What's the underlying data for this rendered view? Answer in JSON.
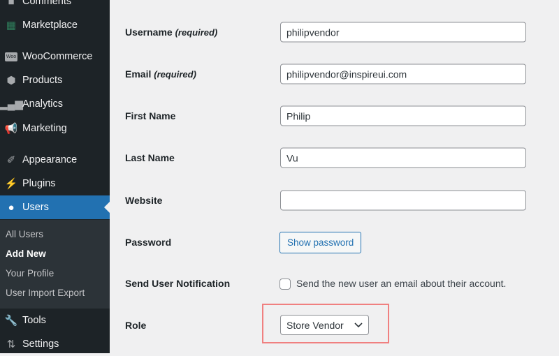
{
  "sidebar": {
    "items": [
      {
        "label": "Comments",
        "icon": "comment-icon"
      },
      {
        "label": "Marketplace",
        "icon": "store-icon"
      },
      {
        "label": "WooCommerce",
        "icon": "woo-icon"
      },
      {
        "label": "Products",
        "icon": "box-icon"
      },
      {
        "label": "Analytics",
        "icon": "bar-chart-icon"
      },
      {
        "label": "Marketing",
        "icon": "megaphone-icon"
      },
      {
        "label": "Appearance",
        "icon": "brush-icon"
      },
      {
        "label": "Plugins",
        "icon": "plug-icon"
      },
      {
        "label": "Users",
        "icon": "user-icon",
        "active": true
      },
      {
        "label": "Tools",
        "icon": "wrench-icon"
      },
      {
        "label": "Settings",
        "icon": "sliders-icon"
      }
    ],
    "submenu": [
      {
        "label": "All Users"
      },
      {
        "label": "Add New",
        "current": true
      },
      {
        "label": "Your Profile"
      },
      {
        "label": "User Import Export"
      }
    ]
  },
  "form": {
    "username": {
      "label": "Username",
      "req": "(required)",
      "value": "philipvendor"
    },
    "email": {
      "label": "Email",
      "req": "(required)",
      "value": "philipvendor@inspireui.com"
    },
    "first_name": {
      "label": "First Name",
      "value": "Philip"
    },
    "last_name": {
      "label": "Last Name",
      "value": "Vu"
    },
    "website": {
      "label": "Website",
      "value": ""
    },
    "password": {
      "label": "Password",
      "button": "Show password"
    },
    "notify": {
      "label": "Send User Notification",
      "checkbox_label": "Send the new user an email about their account.",
      "checked": false
    },
    "role": {
      "label": "Role",
      "value": "Store Vendor"
    }
  },
  "colors": {
    "accent": "#2271b1",
    "sidebar": "#1d2327",
    "highlight": "#f08080"
  }
}
